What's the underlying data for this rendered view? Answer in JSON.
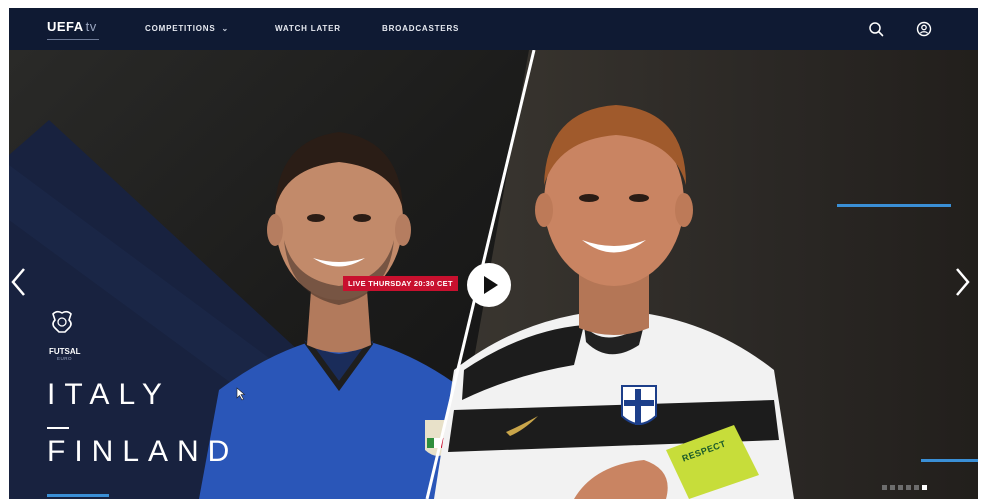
{
  "header": {
    "logo_main": "UEFA",
    "logo_suffix": "tv",
    "nav": {
      "competitions": "COMPETITIONS",
      "watch_later": "WATCH LATER",
      "broadcasters": "BROADCASTERS"
    },
    "icons": [
      "search-icon",
      "user-account-icon"
    ]
  },
  "hero": {
    "live_badge": "LIVE THURSDAY 20:30 CET",
    "competition_name": "FUTSAL",
    "competition_sub": "EURO",
    "team_home": "ITALY",
    "team_away": "FINLAND",
    "armband_text": "RESPECT",
    "slides_total": 6,
    "slide_active": 6
  },
  "colors": {
    "header_bg": "#0f1a33",
    "panel_navy": "#18223f",
    "accent_blue": "#3a8fd6",
    "live_red": "#c8102e",
    "italy_blue": "#2a56b8",
    "finland_captain_band": "#c7dd3a"
  }
}
